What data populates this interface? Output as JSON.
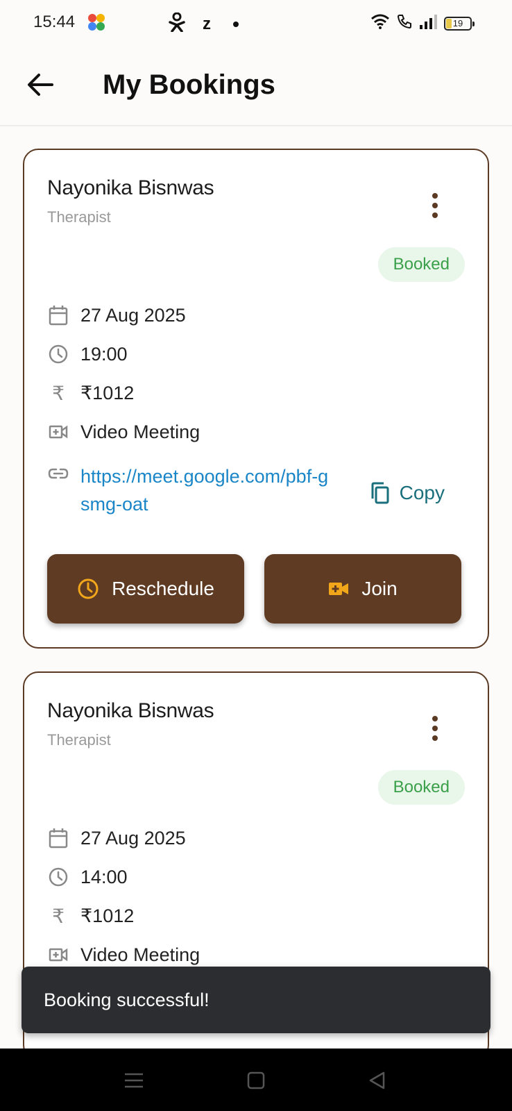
{
  "status_bar": {
    "time": "15:44",
    "battery_level": "19",
    "left_icons": [
      "app-icon",
      "accessibility-icon",
      "z-icon",
      "dot-icon"
    ],
    "right_icons": [
      "wifi-icon",
      "call-icon",
      "signal-icon",
      "battery-icon"
    ]
  },
  "app_bar": {
    "title": "My Bookings"
  },
  "bookings": [
    {
      "name": "Nayonika Bisnwas",
      "role": "Therapist",
      "status": "Booked",
      "date": "27 Aug 2025",
      "time": "19:00",
      "price": "₹1012",
      "meeting_type": "Video Meeting",
      "link": "https://meet.google.com/pbf-gsmg-oat",
      "copy_label": "Copy",
      "reschedule_label": "Reschedule",
      "join_label": "Join"
    },
    {
      "name": "Nayonika Bisnwas",
      "role": "Therapist",
      "status": "Booked",
      "date": "27 Aug 2025",
      "time": "14:00",
      "price": "₹1012",
      "meeting_type": "Video Meeting"
    }
  ],
  "snackbar": {
    "message": "Booking successful!"
  },
  "colors": {
    "brand_brown": "#5e3b22",
    "status_green": "#3aa04a",
    "link_blue": "#1a86c7",
    "accent_orange": "#f2a71b"
  }
}
